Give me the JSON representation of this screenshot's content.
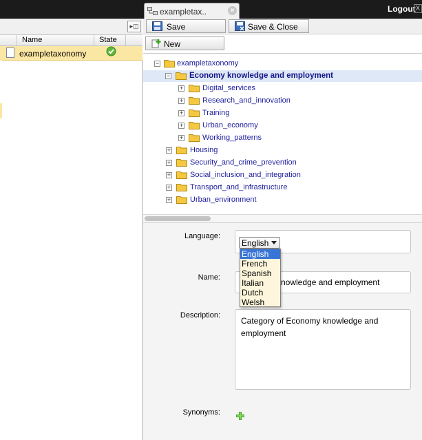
{
  "topbar": {
    "tab_label": "exampletax..",
    "tab_close": "×",
    "logout_label": "Logout",
    "logout_close": "X"
  },
  "left_panel": {
    "collapse_icon": "▸◫",
    "columns": {
      "name": "Name",
      "state": "State"
    },
    "rows": [
      {
        "name": "exampletaxonomy",
        "state_icon": "check-circle-icon"
      }
    ]
  },
  "toolbar": {
    "save_label": "Save",
    "save_close_label": "Save & Close",
    "new_label": "New"
  },
  "tree": {
    "root": "exampletaxonomy",
    "selected": "Economy knowledge and employment",
    "children_of_selected": [
      "Digital_services",
      "Research_and_innovation",
      "Training",
      "Urban_economy",
      "Working_patterns"
    ],
    "siblings": [
      "Housing",
      "Security_and_crime_prevention",
      "Social_inclusion_and_integration",
      "Transport_and_infrastructure",
      "Urban_environment"
    ],
    "expand_symbol": "+",
    "collapse_symbol": "−"
  },
  "form": {
    "language_label": "Language:",
    "language_value": "English",
    "language_options": [
      "English",
      "French",
      "Spanish",
      "Italian",
      "Dutch",
      "Welsh"
    ],
    "name_label": "Name:",
    "name_value_visible": "knowledge and employment",
    "description_label": "Description:",
    "description_value": "Category of Economy knowledge and employment",
    "synonyms_label": "Synonyms:"
  },
  "colors": {
    "topbar_bg": "#1b1b1b",
    "selected_row_bg": "#fbe7a4",
    "tree_selected_bg": "#dfe8f6",
    "tree_text": "#1e1e9e",
    "dropdown_highlight": "#3875d7",
    "folder": "#f5c842"
  }
}
